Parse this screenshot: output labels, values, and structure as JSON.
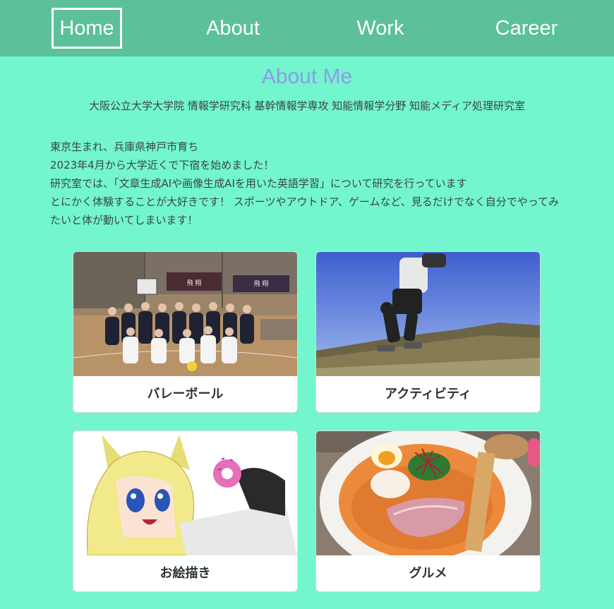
{
  "nav": {
    "items": [
      {
        "label": "Home",
        "active": true
      },
      {
        "label": "About",
        "active": false
      },
      {
        "label": "Work",
        "active": false
      },
      {
        "label": "Career",
        "active": false
      }
    ]
  },
  "about": {
    "title": "About Me",
    "affiliation": "大阪公立大学大学院 情報学研究科 基幹情報学専攻 知能情報学分野 知能メディア処理研究室",
    "intro": [
      "東京生まれ、兵庫県神戸市育ち",
      "2023年4月から大学近くで下宿を始めました！",
      "研究室では、「文章生成AIや画像生成AIを用いた英語学習」について研究を行っています",
      "とにかく体験することが大好きです！ スポーツやアウトドア、ゲームなど、見るだけでなく自分でやってみたいと体が動いてしまいます！"
    ]
  },
  "cards": [
    {
      "caption": "バレーボール",
      "image": "volleyball-team-photo"
    },
    {
      "caption": "アクティビティ",
      "image": "jumping-on-hill-photo"
    },
    {
      "caption": "お絵描き",
      "image": "anime-girl-donut-drawing"
    },
    {
      "caption": "グルメ",
      "image": "ramen-bowl-photo"
    }
  ],
  "colors": {
    "background": "#73f5cd",
    "navbar": "#5cc09a",
    "title": "#8c9ce8",
    "text": "#3a4745",
    "card": "#ffffff"
  }
}
